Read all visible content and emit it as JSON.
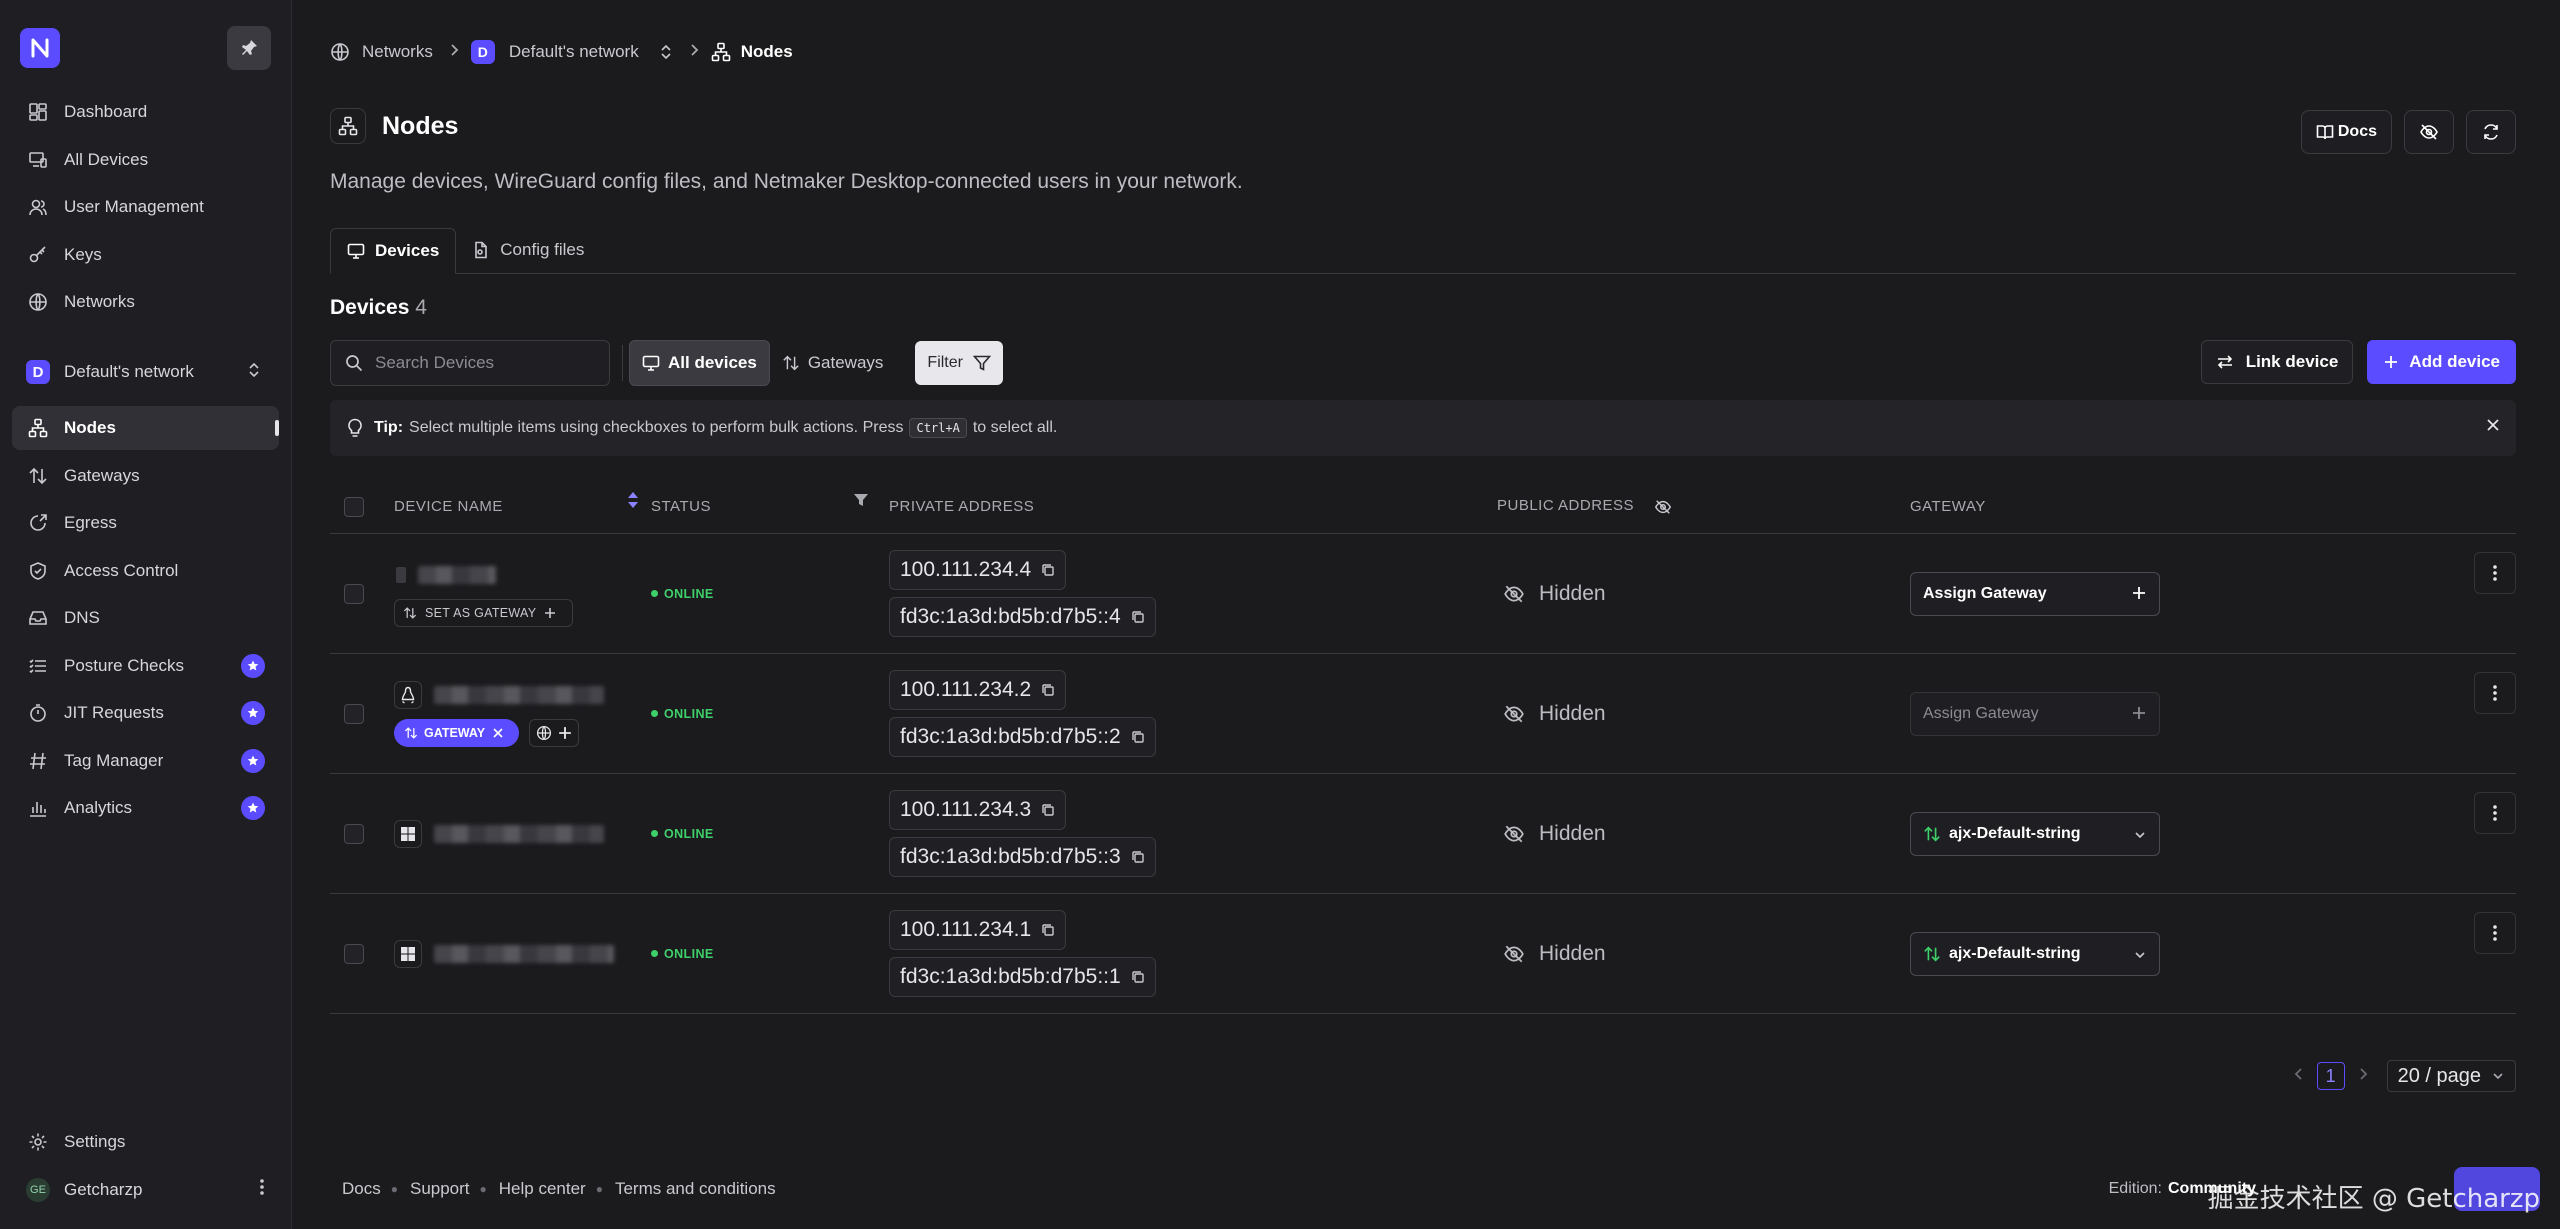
{
  "sidebar": {
    "items": [
      {
        "label": "Dashboard"
      },
      {
        "label": "All Devices"
      },
      {
        "label": "User Management"
      },
      {
        "label": "Keys"
      },
      {
        "label": "Networks"
      }
    ],
    "network": {
      "initial": "D",
      "name": "Default's network"
    },
    "network_items": [
      {
        "label": "Nodes"
      },
      {
        "label": "Gateways"
      },
      {
        "label": "Egress"
      },
      {
        "label": "Access Control"
      },
      {
        "label": "DNS"
      },
      {
        "label": "Posture Checks"
      },
      {
        "label": "JIT Requests"
      },
      {
        "label": "Tag Manager"
      },
      {
        "label": "Analytics"
      }
    ],
    "settings": "Settings",
    "user": {
      "initials": "GE",
      "name": "Getcharzp"
    }
  },
  "breadcrumb": {
    "networks": "Networks",
    "network_initial": "D",
    "network": "Default's network",
    "current": "Nodes"
  },
  "header": {
    "title": "Nodes",
    "subtitle": "Manage devices, WireGuard config files, and Netmaker Desktop-connected users in your network.",
    "docs_label": "Docs"
  },
  "tabs": [
    {
      "label": "Devices"
    },
    {
      "label": "Config files"
    }
  ],
  "devices": {
    "heading": "Devices",
    "count": "4",
    "search_placeholder": "Search Devices",
    "all_devices_label": "All devices",
    "gateways_label": "Gateways",
    "filter_label": "Filter",
    "link_device_label": "Link device",
    "add_device_label": "Add device"
  },
  "tip": {
    "bold": "Tip:",
    "text_before": "Select multiple items using checkboxes to perform bulk actions. Press",
    "kbd": "Ctrl+A",
    "text_after": "to select all."
  },
  "table": {
    "headers": {
      "name": "DEVICE NAME",
      "status": "STATUS",
      "private": "PRIVATE ADDRESS",
      "public": "PUBLIC ADDRESS",
      "gateway": "GATEWAY"
    },
    "rows": [
      {
        "os": "generic",
        "tag": "SET AS GATEWAY",
        "status": "ONLINE",
        "ipv4": "100.111.234.4",
        "ipv6": "fd3c:1a3d:bd5b:d7b5::4",
        "public": "Hidden",
        "gateway": "Assign Gateway"
      },
      {
        "os": "linux",
        "tag": "GATEWAY",
        "status": "ONLINE",
        "ipv4": "100.111.234.2",
        "ipv6": "fd3c:1a3d:bd5b:d7b5::2",
        "public": "Hidden",
        "gateway": "Assign Gateway"
      },
      {
        "os": "windows",
        "status": "ONLINE",
        "ipv4": "100.111.234.3",
        "ipv6": "fd3c:1a3d:bd5b:d7b5::3",
        "public": "Hidden",
        "gateway": "ajx-Default-string"
      },
      {
        "os": "windows",
        "status": "ONLINE",
        "ipv4": "100.111.234.1",
        "ipv6": "fd3c:1a3d:bd5b:d7b5::1",
        "public": "Hidden",
        "gateway": "ajx-Default-string"
      }
    ]
  },
  "pagination": {
    "page": "1",
    "per_page": "20 / page"
  },
  "footer": {
    "links": [
      "Docs",
      "Support",
      "Help center",
      "Terms and conditions"
    ],
    "edition_label": "Edition:",
    "edition_value": "Community",
    "watermark": "掘金技术社区 @ Getcharzp"
  },
  "colors": {
    "accent": "#5b4dff",
    "online": "#3ecf6a",
    "background": "#1b1b1e"
  }
}
